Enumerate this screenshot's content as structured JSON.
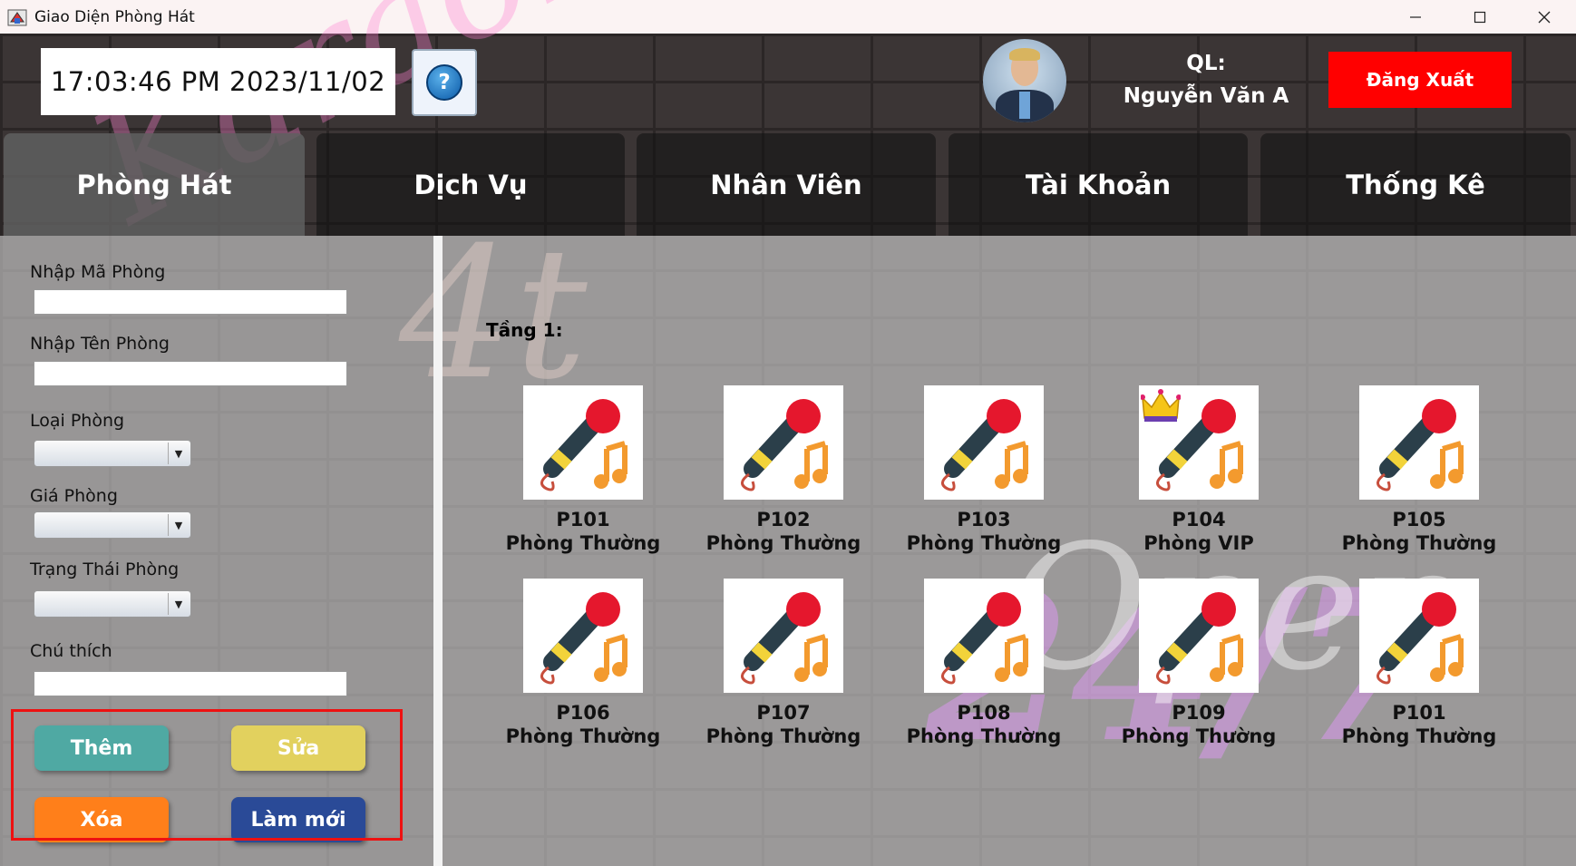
{
  "window": {
    "title": "Giao Diện Phòng Hát"
  },
  "header": {
    "clock": "17:03:46 PM  2023/11/02",
    "manager_prefix": "QL:",
    "manager_name": "Nguyễn Văn A",
    "logout_label": "Đăng Xuất"
  },
  "nav": {
    "tabs": [
      {
        "label": "Phòng Hát",
        "active": true
      },
      {
        "label": "Dịch Vụ"
      },
      {
        "label": "Nhân Viên"
      },
      {
        "label": "Tài Khoản"
      },
      {
        "label": "Thống Kê"
      }
    ]
  },
  "form": {
    "room_code_label": "Nhập Mã Phòng",
    "room_name_label": "Nhập Tên Phòng",
    "room_type_label": "Loại Phòng",
    "price_label": "Giá Phòng",
    "status_label": "Trạng Thái Phòng",
    "note_label": "Chú thích",
    "room_code_value": "",
    "room_name_value": "",
    "note_value": ""
  },
  "actions": {
    "add": "Thêm",
    "edit": "Sửa",
    "delete": "Xóa",
    "refresh": "Làm mới"
  },
  "floor": {
    "label": "Tầng 1:"
  },
  "rooms": [
    {
      "code": "P101",
      "type": "Phòng Thường",
      "vip": false
    },
    {
      "code": "P102",
      "type": "Phòng Thường",
      "vip": false
    },
    {
      "code": "P103",
      "type": "Phòng Thường",
      "vip": false
    },
    {
      "code": "P104",
      "type": "Phòng VIP",
      "vip": true
    },
    {
      "code": "P105",
      "type": "Phòng Thường",
      "vip": false
    },
    {
      "code": "P106",
      "type": "Phòng Thường",
      "vip": false
    },
    {
      "code": "P107",
      "type": "Phòng Thường",
      "vip": false
    },
    {
      "code": "P108",
      "type": "Phòng Thường",
      "vip": false
    },
    {
      "code": "P109",
      "type": "Phòng Thường",
      "vip": false
    },
    {
      "code": "P101",
      "type": "Phòng Thường",
      "vip": false
    }
  ],
  "decor": {
    "neon_1": "Karaoke",
    "neon_2": "4t",
    "neon_3": "24/7",
    "neon_4": "Open"
  },
  "colors": {
    "logout": "#ff0000",
    "add": "#4fa9a3",
    "edit": "#e2d15e",
    "delete": "#ff7f1a",
    "refresh": "#2a4a97"
  }
}
